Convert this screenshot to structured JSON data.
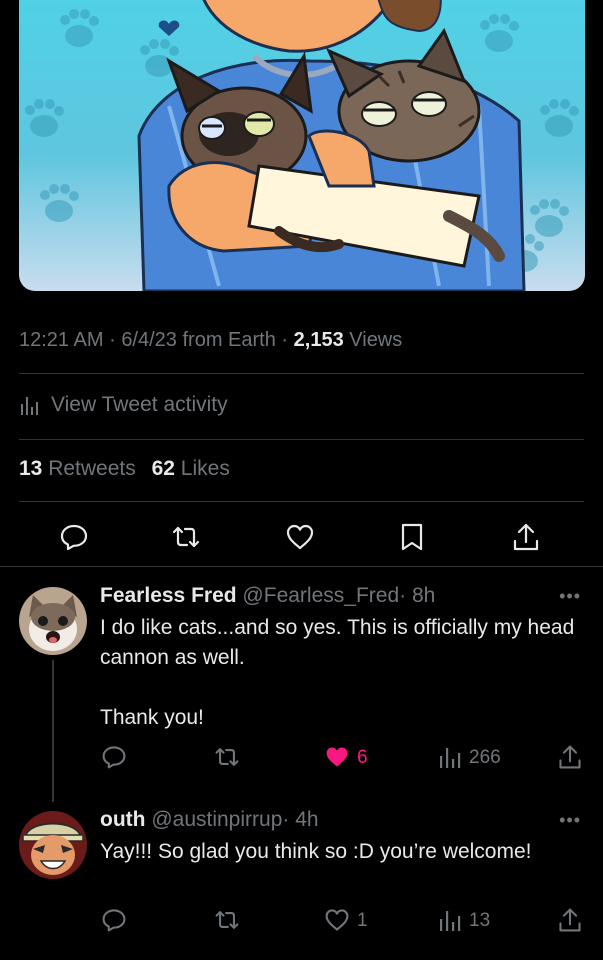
{
  "tweet": {
    "time": "12:21 AM",
    "sep": "·",
    "date": "6/4/23",
    "source": "from Earth",
    "views_count": "2,153",
    "views_label": "Views",
    "activity_label": "View Tweet activity",
    "retweets_count": "13",
    "retweets_label": "Retweets",
    "likes_count": "62",
    "likes_label": "Likes"
  },
  "replies": [
    {
      "name": "Fearless Fred",
      "handle": "@Fearless_Fred",
      "time": "· 8h",
      "text": "I do like cats...and so yes. This is officially my head cannon as well.\n\nThank you!",
      "likes": "6",
      "views": "266",
      "liked": true
    },
    {
      "name": "outh",
      "handle": "@austinpirrup",
      "time": "· 4h",
      "text": "Yay!!! So glad you think so :D you’re welcome!",
      "likes": "1",
      "views": "13",
      "liked": false
    }
  ],
  "more_label": "•••",
  "colors": {
    "background": "#000000",
    "text": "#e7e9ea",
    "muted": "#71767b",
    "divider": "#2f3336",
    "like_pink": "#f91880"
  },
  "icons": [
    "bar-chart-icon",
    "reply-icon",
    "retweet-icon",
    "heart-icon",
    "bookmark-icon",
    "share-icon"
  ]
}
